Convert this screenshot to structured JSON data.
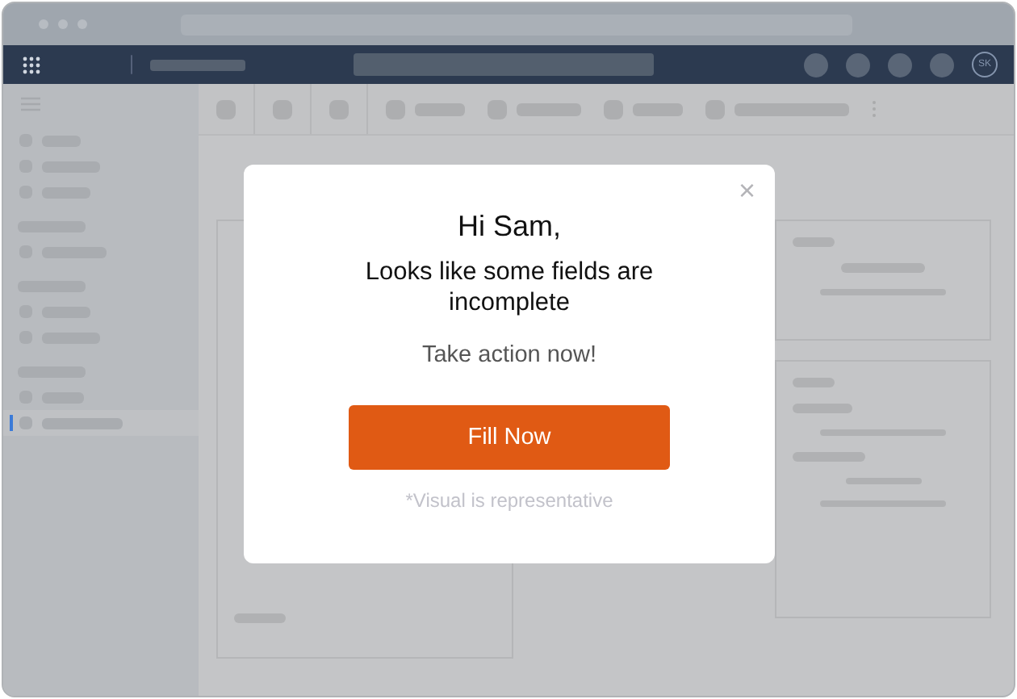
{
  "navbar": {
    "avatar": "SK"
  },
  "sidebar": {
    "items": [
      {
        "kind": "item",
        "selected": false
      },
      {
        "kind": "item",
        "selected": false
      },
      {
        "kind": "item",
        "selected": false
      },
      {
        "kind": "header",
        "selected": false
      },
      {
        "kind": "item",
        "selected": false
      },
      {
        "kind": "header",
        "selected": false
      },
      {
        "kind": "item",
        "selected": false
      },
      {
        "kind": "item",
        "selected": false
      },
      {
        "kind": "header",
        "selected": false
      },
      {
        "kind": "item",
        "selected": false
      },
      {
        "kind": "item",
        "selected": true
      }
    ]
  },
  "modal": {
    "close": "×",
    "title": "Hi Sam,",
    "message": "Looks like some fields are incomplete",
    "prompt": "Take action now!",
    "button": "Fill Now",
    "footnote": "*Visual is representative"
  }
}
